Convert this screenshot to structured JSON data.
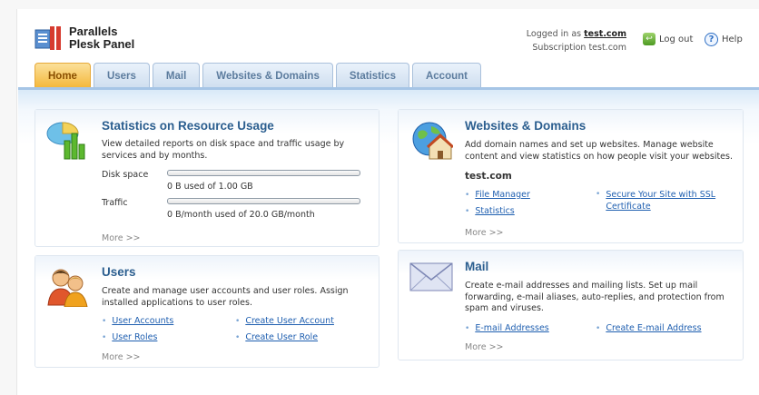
{
  "app": {
    "logo_line1": "Parallels",
    "logo_line2": "Plesk Panel"
  },
  "header": {
    "logged_in_prefix": "Logged in as",
    "user": "test.com",
    "subscription": "Subscription test.com",
    "logout_label": "Log out",
    "help_label": "Help"
  },
  "tabs": [
    {
      "label": "Home",
      "active": true
    },
    {
      "label": "Users",
      "active": false
    },
    {
      "label": "Mail",
      "active": false
    },
    {
      "label": "Websites & Domains",
      "active": false
    },
    {
      "label": "Statistics",
      "active": false
    },
    {
      "label": "Account",
      "active": false
    }
  ],
  "statistics": {
    "title": "Statistics on Resource Usage",
    "description": "View detailed reports on disk space and traffic usage by services and by months.",
    "disk_label": "Disk space",
    "disk_usage": "0 B used of 1.00 GB",
    "disk_fraction": 0,
    "traffic_label": "Traffic",
    "traffic_usage": "0 B/month used of 20.0 GB/month",
    "traffic_fraction": 0,
    "more": "More >>"
  },
  "users": {
    "title": "Users",
    "description": "Create and manage user accounts and user roles. Assign installed applications to user roles.",
    "links": [
      "User Accounts",
      "Create User Account",
      "User Roles",
      "Create User Role"
    ],
    "more": "More >>"
  },
  "websites": {
    "title": "Websites & Domains",
    "description": "Add domain names and set up websites. Manage website content and view statistics on how people visit your websites.",
    "domain": "test.com",
    "links": [
      "File Manager",
      "Secure Your Site with SSL Certificate",
      "Statistics"
    ],
    "more": "More >>"
  },
  "mail": {
    "title": "Mail",
    "description": "Create e-mail addresses and mailing lists. Set up mail forwarding, e-mail aliases, auto-replies, and protection from spam and viruses.",
    "links": [
      "E-mail Addresses",
      "Create E-mail Address"
    ],
    "more": "More >>"
  },
  "colors": {
    "accent": "#2b5e8f",
    "link": "#1f5fb0",
    "active_tab": "#f4b739"
  }
}
